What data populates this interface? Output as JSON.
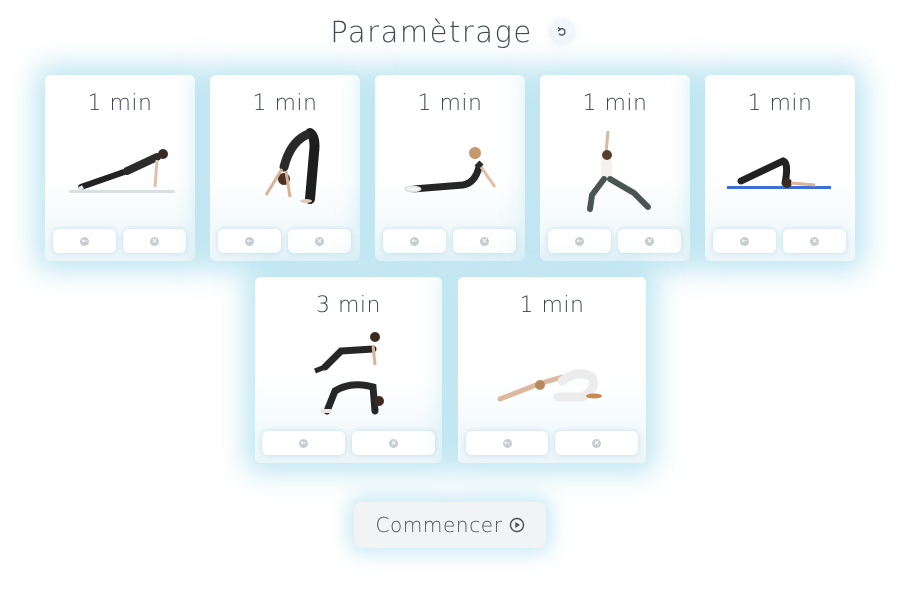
{
  "header": {
    "title": "Paramètrage",
    "reset_icon": "undo-icon"
  },
  "exercises": [
    {
      "duration": "1 min",
      "pose": "plank",
      "back_icon": "arrow-left-icon",
      "remove_icon": "close-icon"
    },
    {
      "duration": "1 min",
      "pose": "standing-forward-bend",
      "back_icon": "arrow-left-icon",
      "remove_icon": "close-icon"
    },
    {
      "duration": "1 min",
      "pose": "cobra",
      "back_icon": "arrow-left-icon",
      "remove_icon": "close-icon"
    },
    {
      "duration": "1 min",
      "pose": "warrior",
      "back_icon": "arrow-left-icon",
      "remove_icon": "close-icon"
    },
    {
      "duration": "1 min",
      "pose": "plough",
      "back_icon": "arrow-left-icon",
      "remove_icon": "close-icon"
    },
    {
      "duration": "3 min",
      "pose": "cat-cow",
      "back_icon": "arrow-left-icon",
      "remove_icon": "close-icon"
    },
    {
      "duration": "1 min",
      "pose": "child-pose",
      "back_icon": "arrow-left-icon",
      "remove_icon": "close-icon"
    }
  ],
  "footer": {
    "start_label": "Commencer",
    "start_icon": "play-circle-icon"
  }
}
